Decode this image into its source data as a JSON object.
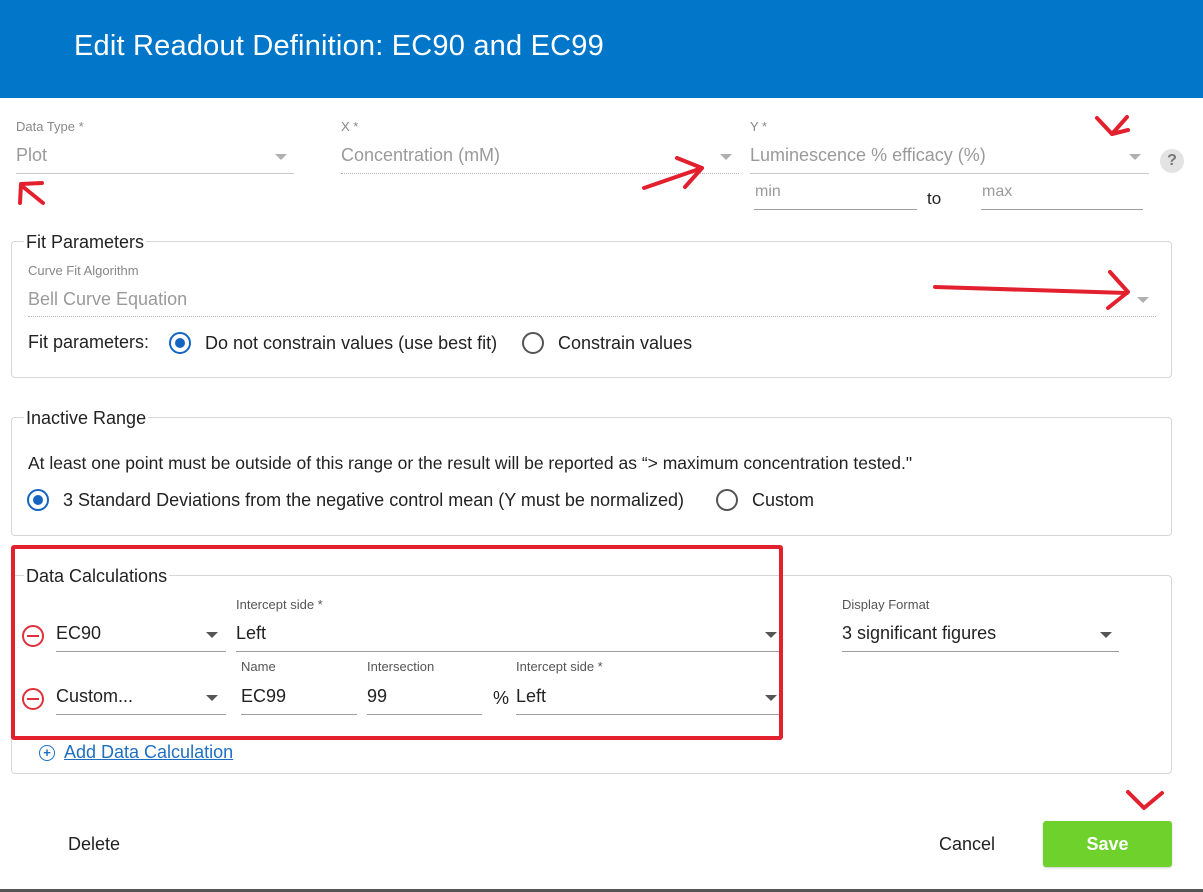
{
  "dialog": {
    "title": "Edit Readout Definition: EC90 and EC99"
  },
  "data_type": {
    "label": "Data Type *",
    "value": "Plot"
  },
  "x_axis": {
    "label": "X *",
    "value": "Concentration (mM)"
  },
  "y_axis": {
    "label": "Y *",
    "value": "Luminescence % efficacy (%)",
    "min_placeholder": "min",
    "to_label": "to",
    "max_placeholder": "max",
    "help_icon": "?"
  },
  "fit_parameters": {
    "legend": "Fit Parameters",
    "algorithm_label": "Curve Fit Algorithm",
    "algorithm_value": "Bell Curve Equation",
    "params_label": "Fit parameters:",
    "options": [
      {
        "label": "Do not constrain values (use best fit)",
        "selected": true
      },
      {
        "label": "Constrain values",
        "selected": false
      }
    ]
  },
  "inactive_range": {
    "legend": "Inactive Range",
    "description": "At least one point must be outside of this range or the result will be reported as “> maximum concentration tested.\"",
    "options": [
      {
        "label": "3 Standard Deviations from the negative control mean (Y must be normalized)",
        "selected": true
      },
      {
        "label": "Custom",
        "selected": false
      }
    ]
  },
  "data_calculations": {
    "legend": "Data Calculations",
    "row1": {
      "type": "EC90",
      "intercept_label": "Intercept side *",
      "intercept_value": "Left"
    },
    "row2": {
      "type": "Custom...",
      "name_label": "Name",
      "name_value": "EC99",
      "intersection_label": "Intersection",
      "intersection_value": "99",
      "percent": "%",
      "intercept_label": "Intercept side *",
      "intercept_value": "Left"
    },
    "display_format_label": "Display Format",
    "display_format_value": "3 significant figures",
    "add_link": "Add Data Calculation"
  },
  "footer": {
    "delete": "Delete",
    "cancel": "Cancel",
    "save": "Save"
  },
  "colors": {
    "header": "#0277c9",
    "save": "#6fd12c",
    "annotation": "#e2202e",
    "link": "#1f6fc1"
  },
  "icons": [
    "chevron-down-icon",
    "help-icon",
    "remove-circle-icon",
    "add-circle-icon",
    "annotation-arrow-icon"
  ]
}
